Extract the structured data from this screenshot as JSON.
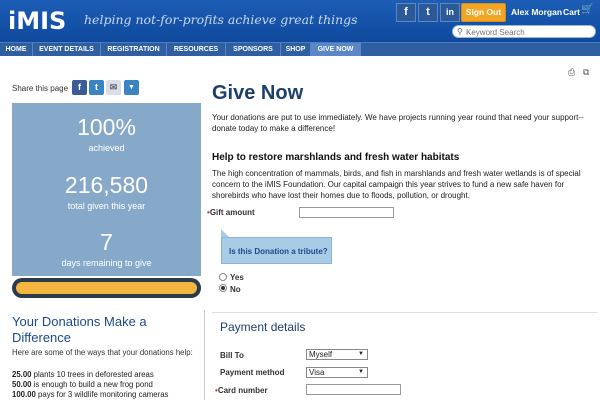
{
  "header": {
    "logo": "iMIS",
    "tagline": "helping not-for-profits achieve great things",
    "social": {
      "facebook": "f",
      "twitter": "t",
      "linkedin": "in"
    },
    "sign_out": "Sign Out",
    "user_name": "Alex Morgan",
    "cart": "Cart",
    "search_placeholder": "Keyword Search"
  },
  "nav": {
    "items": [
      {
        "label": "HOME"
      },
      {
        "label": "EVENT DETAILS"
      },
      {
        "label": "REGISTRATION"
      },
      {
        "label": "RESOURCES"
      },
      {
        "label": "SPONSORS"
      },
      {
        "label": "SHOP"
      },
      {
        "label": "GIVE NOW",
        "active": true
      }
    ]
  },
  "share": {
    "label": "Share this page"
  },
  "stats": {
    "percent": "100%",
    "percent_label": "achieved",
    "total": "216,580",
    "total_label": "total given this year",
    "days": "7",
    "days_label": "days remaining to give",
    "progress": 1.0
  },
  "donations": {
    "title": "Your Donations Make a Difference",
    "subtitle": "Here are some of the ways that your donations help:",
    "items": [
      {
        "amount": "25.00",
        "text": " plants 10 trees in deforested areas"
      },
      {
        "amount": "50.00",
        "text": " is enough to build a new frog pond"
      },
      {
        "amount": "100.00",
        "text": " pays for 3 wildlife monitoring cameras"
      }
    ]
  },
  "main": {
    "title": "Give Now",
    "intro": "Your donations are put to use immediately. We have projects running year round that need your support--donate today to make a difference!",
    "section_title": "Help to restore marshlands and fresh water habitats",
    "section_body": "The high concentration of mammals, birds, and fish in marshlands and fresh water wetlands is of special concern to the iMIS Foundation. Our capital campaign this year strives to fund a new safe haven for shorebirds who have lost their homes due to floods, pollution, or drought.",
    "gift_label": "Gift amount",
    "gift_value": "",
    "tribute_question": "Is this Donation a tribute?",
    "radio_yes": "Yes",
    "radio_no": "No",
    "radio_selected": "No"
  },
  "payment": {
    "title": "Payment details",
    "bill_to_label": "Bill To",
    "bill_to_value": "Myself",
    "method_label": "Payment method",
    "method_value": "Visa",
    "card_label": "Card number"
  },
  "colors": {
    "header_blue": "#1c5db5",
    "nav_blue": "#2f5ea1",
    "accent_orange": "#f2a623",
    "stats_panel": "#87a9c9",
    "title_navy": "#1c3f6e"
  }
}
